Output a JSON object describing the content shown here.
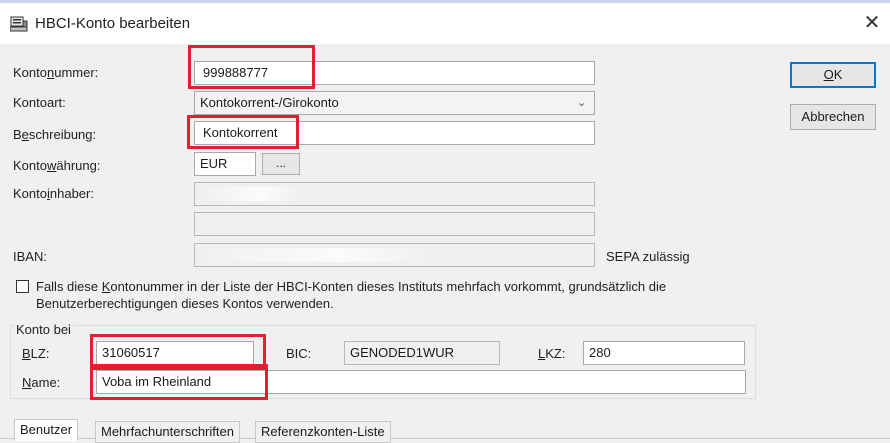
{
  "window": {
    "title": "HBCI-Konto bearbeiten",
    "close_glyph": "✕"
  },
  "form": {
    "kontonummer": {
      "label_pre": "Konto",
      "label_u": "n",
      "label_post": "ummer:",
      "value": "999888777"
    },
    "kontoart": {
      "label": "Kontoart:",
      "value": "Kontokorrent-/Girokonto"
    },
    "beschreibung": {
      "label_pre": "B",
      "label_u": "e",
      "label_post": "schreibung:",
      "value": "Kontokorrent"
    },
    "waehrung": {
      "label_pre": "Konto",
      "label_u": "w",
      "label_post": "ährung:",
      "value": "EUR",
      "picker_label": "..."
    },
    "inhaber": {
      "label_pre": "Konto",
      "label_u": "i",
      "label_post": "nhaber:"
    },
    "iban": {
      "label": "IBAN:",
      "sepa": "SEPA zulässig"
    },
    "checkbox": {
      "line1_pre": "Falls diese ",
      "line1_u": "K",
      "line1_post": "ontonummer in der Liste der HBCI-Konten dieses Instituts mehrfach vorkommt, grundsätzlich die",
      "line2": "Benutzerberechtigungen dieses Kontos verwenden."
    }
  },
  "konto_bei": {
    "title": "Konto bei",
    "blz": {
      "label_u": "B",
      "label_post": "LZ:",
      "value": "31060517"
    },
    "bic": {
      "label": "BIC:",
      "value": "GENODED1WUR"
    },
    "lkz": {
      "label_u": "L",
      "label_post": "KZ:",
      "value": "280"
    },
    "name": {
      "label_u": "N",
      "label_post": "ame:",
      "value": "Voba im Rheinland"
    }
  },
  "buttons": {
    "ok_u": "O",
    "ok_post": "K",
    "cancel": "Abbrechen"
  },
  "tabs": [
    "Benutzer",
    "Mehrfachunterschriften",
    "Referenzkonten-Liste"
  ],
  "colors": {
    "highlight": "#e02030",
    "accent": "#0078d7"
  }
}
